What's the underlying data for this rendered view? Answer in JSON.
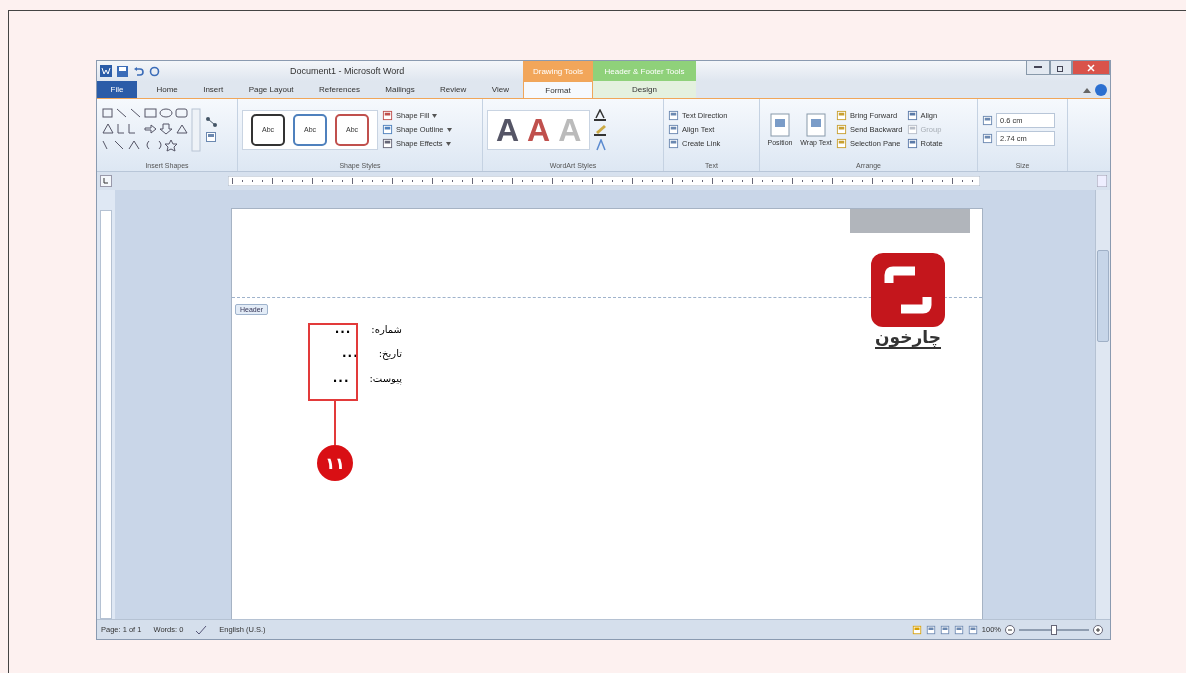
{
  "window": {
    "title": "Document1 - Microsoft Word"
  },
  "context_tabs": [
    {
      "label": "Drawing Tools",
      "color": "#f2a65a"
    },
    {
      "label": "Header & Footer Tools",
      "color": "#8fd17a"
    }
  ],
  "tabs": [
    {
      "label": "File",
      "selected": false,
      "kind": "file"
    },
    {
      "label": "Home",
      "selected": false,
      "kind": "plain"
    },
    {
      "label": "Insert",
      "selected": false,
      "kind": "plain"
    },
    {
      "label": "Page Layout",
      "selected": false,
      "kind": "plain"
    },
    {
      "label": "References",
      "selected": false,
      "kind": "plain"
    },
    {
      "label": "Mailings",
      "selected": false,
      "kind": "plain"
    },
    {
      "label": "Review",
      "selected": false,
      "kind": "plain"
    },
    {
      "label": "View",
      "selected": false,
      "kind": "plain"
    },
    {
      "label": "Format",
      "selected": true,
      "kind": "context"
    },
    {
      "label": "Design",
      "selected": false,
      "kind": "context"
    }
  ],
  "ribbon": {
    "insert_shapes": {
      "title": "Insert Shapes"
    },
    "shape_styles": {
      "title": "Shape Styles",
      "samples": [
        {
          "label": "Abc",
          "color": "#333333"
        },
        {
          "label": "Abc",
          "color": "#4f81bd"
        },
        {
          "label": "Abc",
          "color": "#c0504d"
        }
      ],
      "commands": [
        "Shape Fill",
        "Shape Outline",
        "Shape Effects"
      ]
    },
    "wordart_styles": {
      "title": "WordArt Styles",
      "samples": [
        {
          "label": "A",
          "color": "#555566"
        },
        {
          "label": "A",
          "color": "#c0504d"
        },
        {
          "label": "A",
          "color": "#bbbbbb"
        }
      ]
    },
    "text": {
      "title": "Text",
      "commands": [
        "Text Direction",
        "Align Text",
        "Create Link"
      ]
    },
    "arrange": {
      "title": "Arrange",
      "large": [
        "Position",
        "Wrap Text"
      ],
      "commands": [
        {
          "label": "Bring Forward",
          "disabled": false
        },
        {
          "label": "Send Backward",
          "disabled": false
        },
        {
          "label": "Selection Pane",
          "disabled": false
        },
        {
          "label": "Align",
          "disabled": false
        },
        {
          "label": "Group",
          "disabled": true
        },
        {
          "label": "Rotate",
          "disabled": false
        }
      ]
    },
    "size": {
      "title": "Size",
      "fields": [
        "0.6 cm",
        "2.74 cm"
      ]
    }
  },
  "document": {
    "header_tag": "Header",
    "lines": [
      {
        "label": "شماره:",
        "value": "..."
      },
      {
        "label": "تاریخ:",
        "value": "..."
      },
      {
        "label": "پیوست:",
        "value": "..."
      }
    ],
    "logo_text": "چارخون",
    "callout": "۱۱"
  },
  "status_bar": {
    "page": "Page: 1 of 1",
    "words": "Words: 0",
    "language": "English (U.S.)",
    "zoom": "100%",
    "zoom_slider": {
      "level": 0.5
    }
  }
}
